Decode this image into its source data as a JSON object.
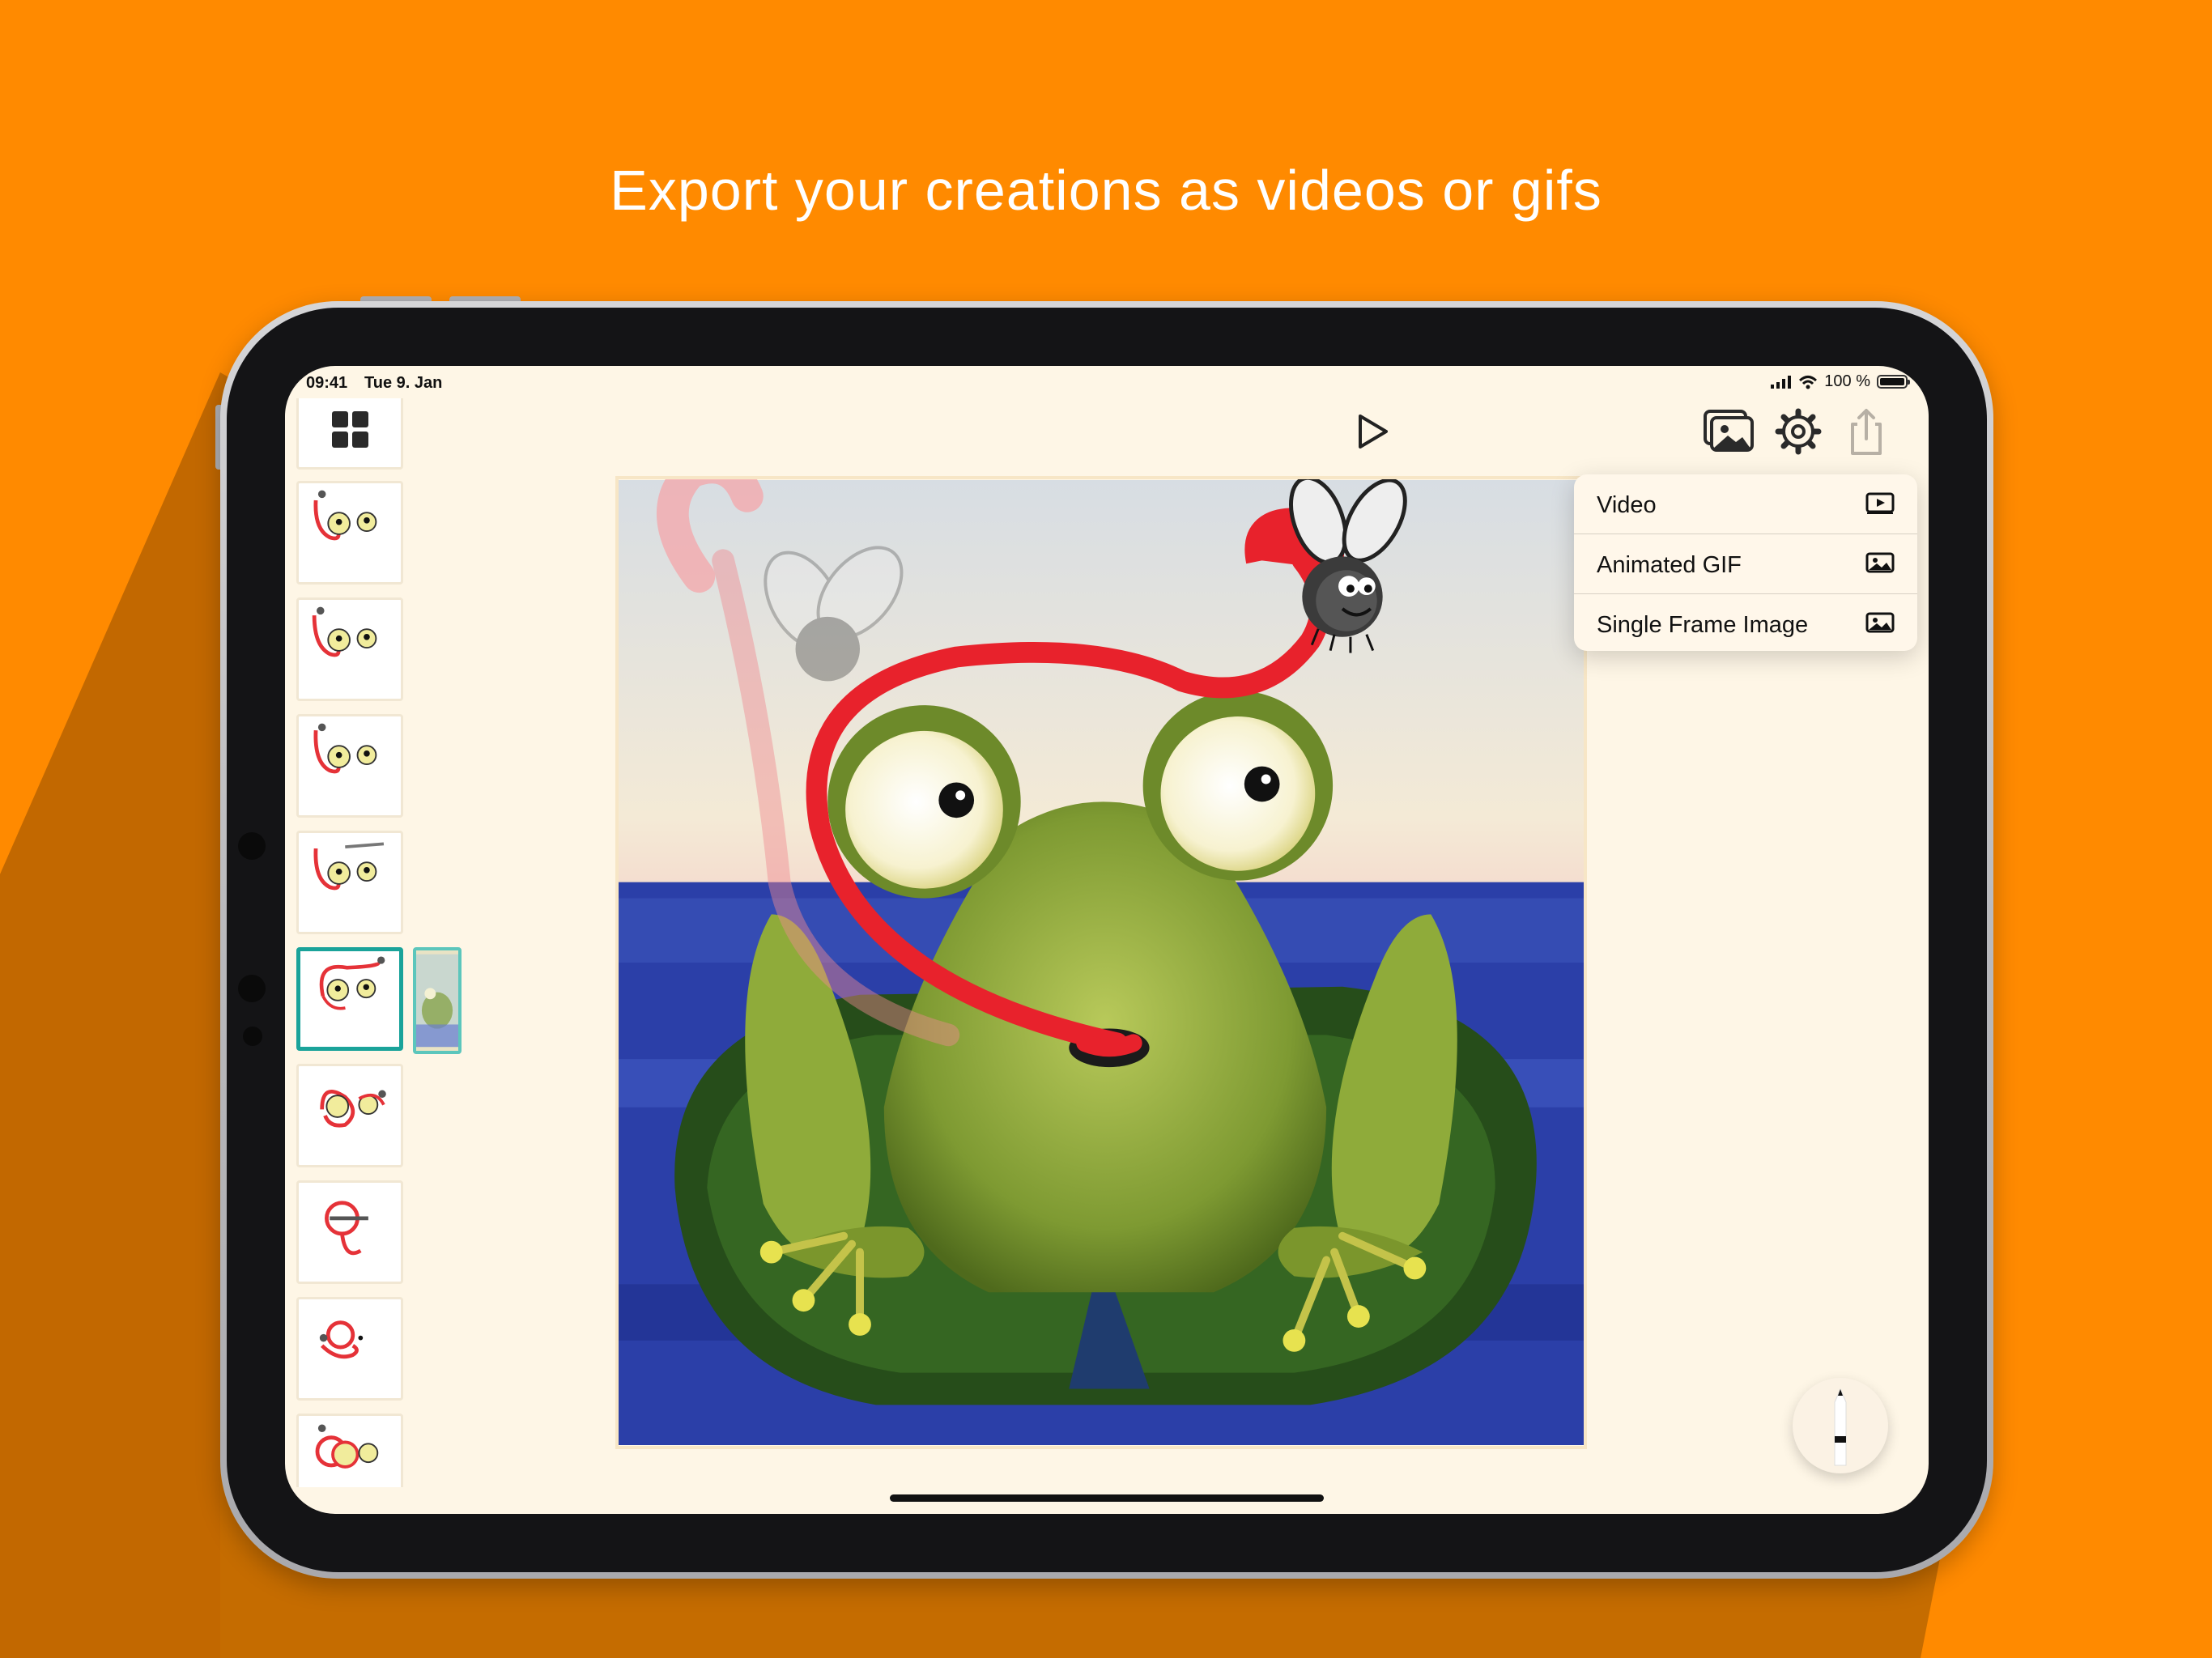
{
  "marketing": {
    "headline": "Export your creations as videos or gifs",
    "background_color": "#ff8a00"
  },
  "status_bar": {
    "time": "09:41",
    "date": "Tue 9. Jan",
    "battery": "100 %"
  },
  "toolbar": {
    "play_icon": "play-icon",
    "gallery_icon": "photo-gallery-icon",
    "settings_icon": "gear-icon",
    "share_icon": "share-icon"
  },
  "export_menu": {
    "items": [
      {
        "label": "Video",
        "icon": "video-icon"
      },
      {
        "label": "Animated GIF",
        "icon": "image-icon"
      },
      {
        "label": "Single Frame Image",
        "icon": "image-icon"
      }
    ]
  },
  "sidebar": {
    "grid_icon": "grid-icon",
    "frame_count_visible": 9,
    "selected_frame": 5
  },
  "canvas": {
    "subject": "frog-on-lily-pad-with-fly"
  },
  "accent_color": "#1aa39a"
}
